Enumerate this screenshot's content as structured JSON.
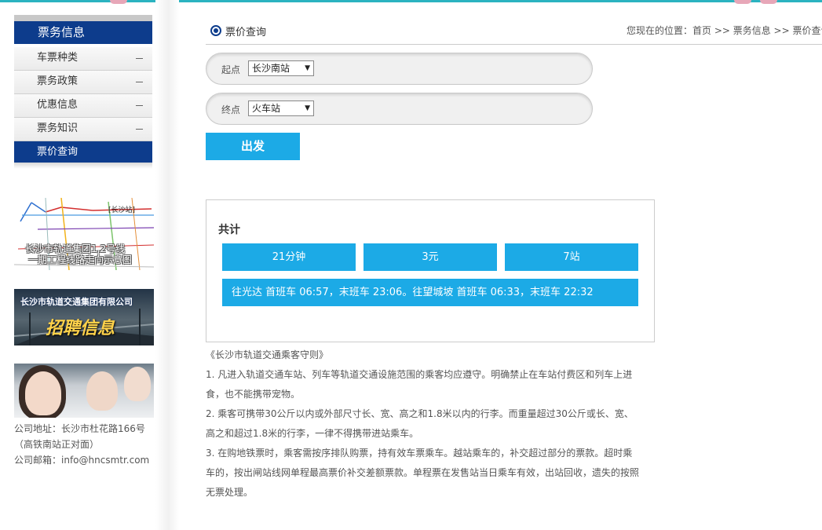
{
  "sidebar": {
    "title": "票务信息",
    "items": [
      {
        "label": "车票种类"
      },
      {
        "label": "票务政策"
      },
      {
        "label": "优惠信息"
      },
      {
        "label": "票务知识"
      },
      {
        "label": "票价查询"
      }
    ]
  },
  "banners": {
    "map_line1": "长沙市轨道集团1,2号线",
    "map_line2": "一期工程线路走向示意图",
    "map_tag": "[长沙站]",
    "recruit_company": "长沙市轨道交通集团有限公司",
    "recruit_title": "招聘信息"
  },
  "contact": {
    "address": "公司地址：长沙市杜花路166号",
    "address_note": "（高铁南站正对面）",
    "email": "公司邮箱：info@hncsmtr.com"
  },
  "header": {
    "title": "票价查询",
    "breadcrumb": "您现在的位置：首页 >> 票务信息 >> 票价查询"
  },
  "form": {
    "start_label": "起点",
    "start_value": "长沙南站",
    "end_label": "终点",
    "end_value": "火车站",
    "submit_label": "出发"
  },
  "result": {
    "total_label": "共计",
    "time": "21分钟",
    "price": "3元",
    "stations": "7站",
    "first_last": "往光达 首班车 06:57，末班车 23:06。往望城坡 首班车 06:33，末班车 22:32"
  },
  "rules": {
    "title": "《长沙市轨道交通乘客守则》",
    "items": [
      "1. 凡进入轨道交通车站、列车等轨道交通设施范围的乘客均应遵守。明确禁止在车站付费区和列车上进食，也不能携带宠物。",
      "2. 乘客可携带30公斤以内或外部尺寸长、宽、高之和1.8米以内的行李。而重量超过30公斤或长、宽、高之和超过1.8米的行李，一律不得携带进站乘车。",
      "3. 在购地铁票时，乘客需按序排队购票，持有效车票乘车。越站乘车的，补交超过部分的票款。超时乘车的，按出闸站线网单程最高票价补交差额票款。单程票在发售站当日乘车有效，出站回收，遗失的按照无票处理。"
    ]
  },
  "colors": {
    "navy": "#0d3c8c",
    "accent_blue": "#1caae6",
    "top_line": "#2bb3c0"
  }
}
